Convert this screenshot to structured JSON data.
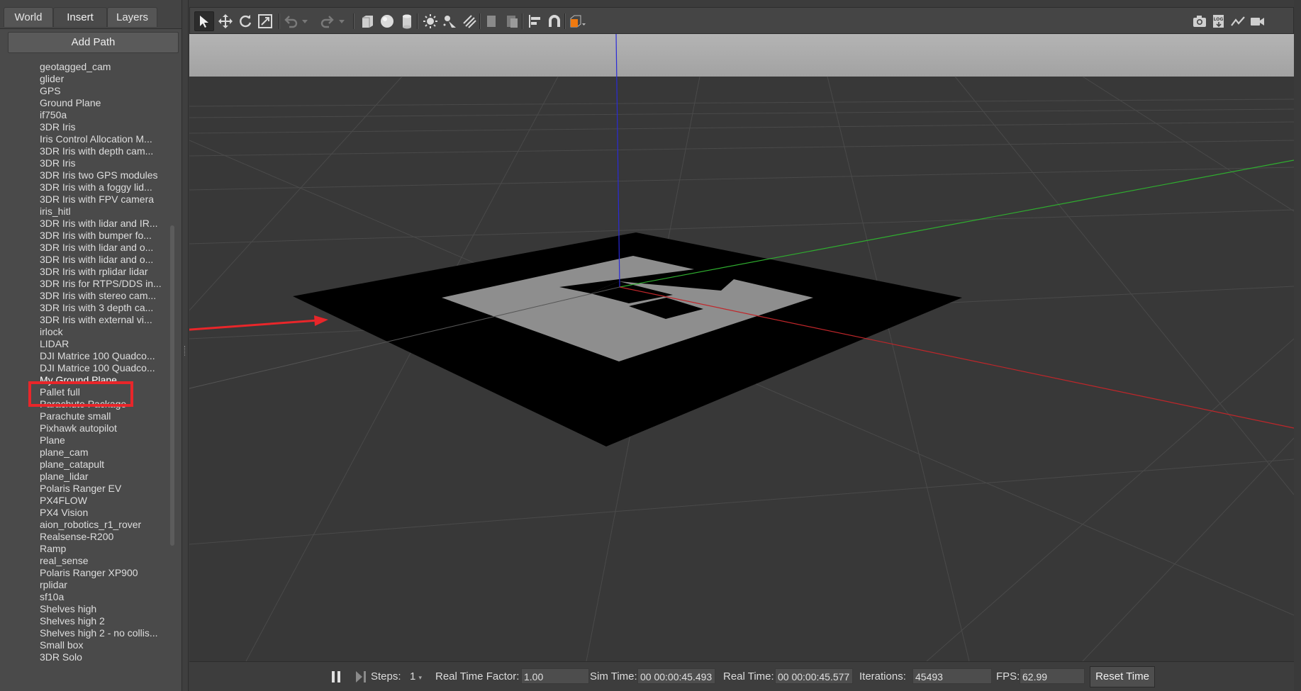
{
  "tabs": [
    {
      "label": "World",
      "active": false
    },
    {
      "label": "Insert",
      "active": true
    },
    {
      "label": "Layers",
      "active": false
    }
  ],
  "add_path_label": "Add Path",
  "models": [
    "geotagged_cam",
    "glider",
    "GPS",
    "Ground Plane",
    "if750a",
    "3DR Iris",
    "Iris Control Allocation M...",
    "3DR Iris with depth cam...",
    "3DR Iris",
    "3DR Iris two GPS modules",
    "3DR Iris with a foggy lid...",
    "3DR Iris with FPV camera",
    "iris_hitl",
    "3DR Iris with lidar and IR...",
    "3DR Iris with bumper fo...",
    "3DR Iris with lidar and o...",
    "3DR Iris with lidar and o...",
    "3DR Iris with rplidar lidar",
    "3DR Iris for RTPS/DDS in...",
    "3DR Iris with stereo cam...",
    "3DR Iris with 3 depth ca...",
    "3DR Iris with external vi...",
    "irlock",
    "LIDAR",
    "DJI Matrice 100 Quadco...",
    "DJI Matrice 100 Quadco...",
    "My Ground Plane",
    "Pallet full",
    "Parachute Package",
    "Parachute small",
    "Pixhawk autopilot",
    "Plane",
    "plane_cam",
    "plane_catapult",
    "plane_lidar",
    "Polaris Ranger EV",
    "PX4FLOW",
    "PX4 Vision",
    "aion_robotics_r1_rover",
    "Realsense-R200",
    "Ramp",
    "real_sense",
    "Polaris Ranger XP900",
    "rplidar",
    "sf10a",
    "Shelves high",
    "Shelves high 2",
    "Shelves high 2 - no collis...",
    "Small box",
    "3DR Solo"
  ],
  "highlighted_model": "My Ground Plane",
  "toolbar": {
    "left_icons": [
      "select-arrow-icon",
      "translate-icon",
      "rotate-icon",
      "scale-icon",
      "undo-icon",
      "undo-dropdown-icon",
      "redo-icon",
      "redo-dropdown-icon",
      "box-icon",
      "sphere-icon",
      "cylinder-icon",
      "point-light-icon",
      "spot-light-icon",
      "directional-light-icon",
      "copy-icon",
      "paste-icon",
      "align-icon",
      "snap-magnet-icon",
      "view-angle-icon"
    ],
    "right_icons": [
      "screenshot-camera-icon",
      "log-icon",
      "plot-icon",
      "video-record-icon"
    ]
  },
  "status": {
    "steps_label": "Steps:",
    "steps_value": "1",
    "rtf_label": "Real Time Factor:",
    "rtf_value": "1.00",
    "sim_time_label": "Sim Time:",
    "sim_time_value": "00 00:00:45.493",
    "real_time_label": "Real Time:",
    "real_time_value": "00 00:00:45.577",
    "iterations_label": "Iterations:",
    "iterations_value": "45493",
    "fps_label": "FPS:",
    "fps_value": "62.99",
    "reset_label": "Reset Time"
  },
  "colors": {
    "highlight": "#e8262a",
    "axis_x": "#c0262a",
    "axis_y": "#2fae2f",
    "axis_z": "#2a2ad8",
    "ground_dark": "#000000",
    "ground_light": "#8e8e8e"
  }
}
